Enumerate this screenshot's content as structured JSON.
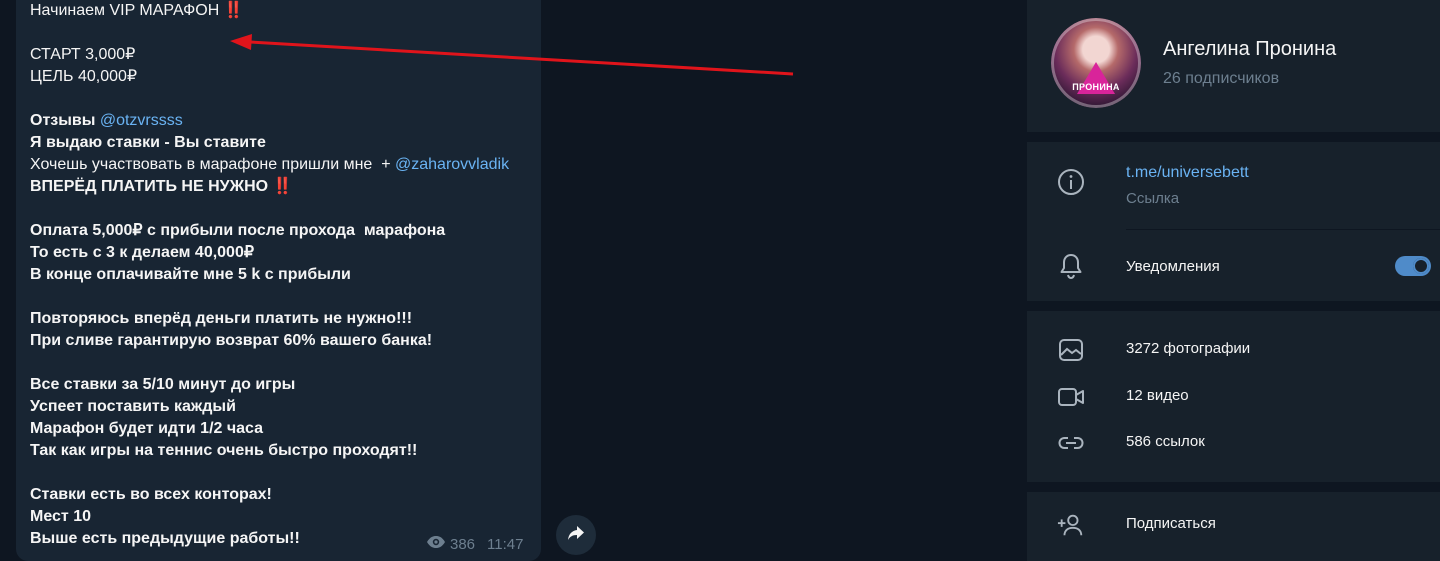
{
  "message": {
    "lines": [
      {
        "text": "Начинаем VIP МАРАФОН",
        "excl": "‼️"
      },
      {
        "text": "СТАРТ 3,000₽"
      },
      {
        "text": "ЦЕЛЬ 40,000₽"
      },
      {
        "prefix": "Отзывы ",
        "link": "@otzvrssss"
      },
      {
        "text": "Я выдаю ставки - Вы ставите"
      },
      {
        "prefix": "Хочешь участвовать в марафоне пришли мне  + ",
        "link": "@zaharovvladik"
      },
      {
        "text": "ВПЕРЁД ПЛАТИТЬ НЕ НУЖНО",
        "excl": "‼️"
      },
      {
        "text": "Оплата 5,000₽ с прибыли после прохода  марафона"
      },
      {
        "text": "То есть с 3 к делаем 40,000₽"
      },
      {
        "text": "В конце оплачивайте мне 5 k с прибыли"
      },
      {
        "text": "Повторяюсь вперёд деньги платить не нужно!!!"
      },
      {
        "text": "При сливе гарантирую возврат 60% вашего банка!"
      },
      {
        "text": "Все ставки за 5/10 минут до игры"
      },
      {
        "text": "Успеет поставить каждый"
      },
      {
        "text": "Марафон будет идти 1/2 часа"
      },
      {
        "text": "Так как игры на теннис очень быстро проходят!!"
      },
      {
        "text": "Ставки есть во всех конторах!"
      },
      {
        "text": "Мест 10"
      },
      {
        "text": "Выше есть предыдущие работы!!"
      }
    ],
    "views": "386",
    "time": "11:47"
  },
  "channel": {
    "name": "Ангелина Пронина",
    "subscribers": "26 подписчиков",
    "avatar_text": "ПРОНИНА",
    "link": "t.me/universebett",
    "link_caption": "Ссылка",
    "notifications_label": "Уведомления",
    "notifications_on": true,
    "photos": "3272 фотографии",
    "videos": "12 видео",
    "links": "586 ссылок",
    "subscribe_label": "Подписаться"
  },
  "icons": {
    "info": "info-icon",
    "bell": "bell-icon",
    "photo": "photo-icon",
    "video": "video-icon",
    "link": "link-icon",
    "add_user": "add-user-icon",
    "eye": "eye-icon",
    "forward": "forward-icon"
  },
  "colors": {
    "accent": "#6ab3f3",
    "toggle": "#4f8bc9",
    "annotation_arrow": "#e0141b"
  }
}
